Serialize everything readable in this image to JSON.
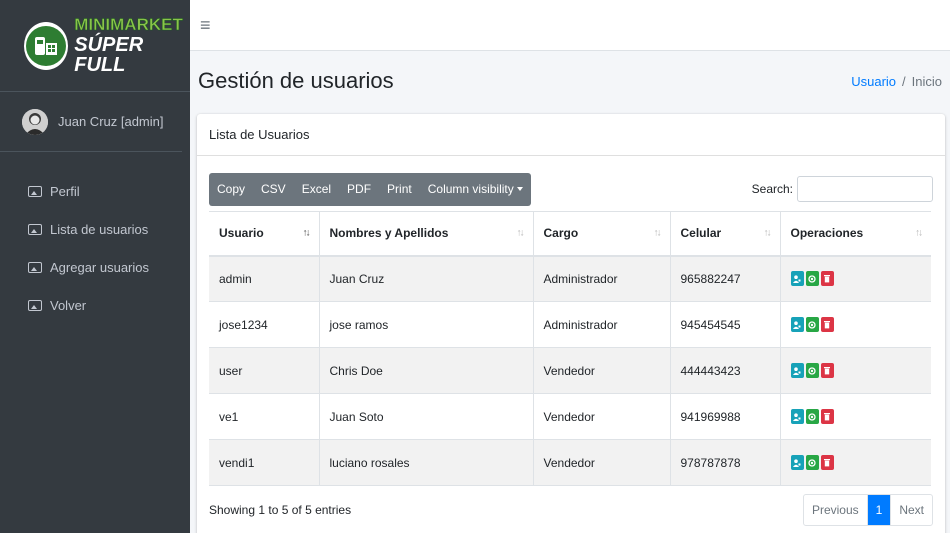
{
  "brand": {
    "line1": "MINIMARKET",
    "line2": "SÚPER FULL"
  },
  "user": {
    "name": "Juan Cruz [admin]"
  },
  "nav": [
    {
      "label": "Perfil"
    },
    {
      "label": "Lista de usuarios"
    },
    {
      "label": "Agregar usuarios"
    },
    {
      "label": "Volver"
    }
  ],
  "header": {
    "title": "Gestión de usuarios",
    "breadcrumb": {
      "link": "Usuario",
      "separator": "/",
      "current": "Inicio"
    }
  },
  "card": {
    "title": "Lista de Usuarios"
  },
  "toolbar": {
    "buttons": [
      "Copy",
      "CSV",
      "Excel",
      "PDF",
      "Print"
    ],
    "column_visibility": "Column visibility"
  },
  "search": {
    "label": "Search:",
    "value": "",
    "placeholder": ""
  },
  "table": {
    "columns": [
      "Usuario",
      "Nombres y Apellidos",
      "Cargo",
      "Celular",
      "Operaciones"
    ],
    "rows": [
      [
        "admin",
        "Juan Cruz",
        "Administrador",
        "965882247"
      ],
      [
        "jose1234",
        "jose ramos",
        "Administrador",
        "945454545"
      ],
      [
        "user",
        "Chris Doe",
        "Vendedor",
        "444443423"
      ],
      [
        "ve1",
        "Juan Soto",
        "Vendedor",
        "941969988"
      ],
      [
        "vendi1",
        "luciano rosales",
        "Vendedor",
        "978787878"
      ]
    ]
  },
  "footer": {
    "info": "Showing 1 to 5 of 5 entries"
  },
  "pagination": {
    "previous": "Previous",
    "current": "1",
    "next": "Next"
  },
  "colors": {
    "sidebar": "#343a40",
    "primary": "#007bff",
    "edit": "#17a2b8",
    "view": "#28a745",
    "delete": "#dc3545"
  },
  "icons": {
    "menu": "hamburger-icon",
    "nav": "image-icon",
    "edit": "user-edit-icon",
    "view": "eye-icon",
    "delete": "trash-icon"
  }
}
